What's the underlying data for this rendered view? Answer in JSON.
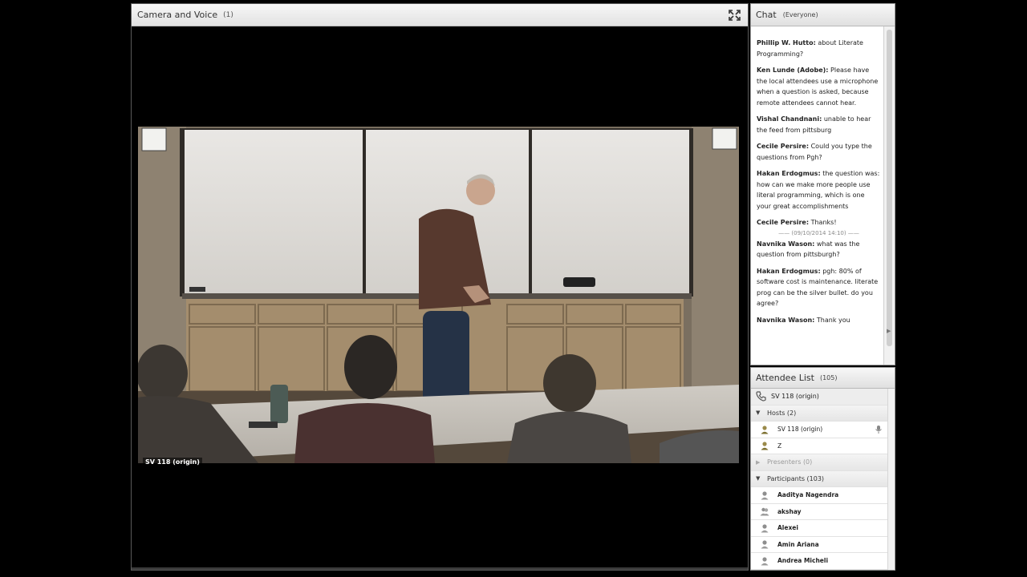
{
  "camera_pod": {
    "title": "Camera and Voice",
    "count": "(1)",
    "video_label": "SV 118 (origin)"
  },
  "chat_pod": {
    "title": "Chat",
    "scope": "(Everyone)",
    "messages": [
      {
        "sender": "Phillip W. Hutto:",
        "text": "about Literate Programming?"
      },
      {
        "sender": "Ken Lunde (Adobe):",
        "text": "Please have the local attendees use a microphone when a question is asked, because remote attendees cannot hear."
      },
      {
        "sender": "Vishal Chandnani:",
        "text": "unable to hear the feed from pittsburg"
      },
      {
        "sender": "Cecile Persire:",
        "text": "Could you type the questions from Pgh?"
      },
      {
        "sender": "Hakan Erdogmus:",
        "text": "the question was: how can we make more people use literal programming, which is one your great accomplishments"
      },
      {
        "sender": "Cecile Persire:",
        "text": "Thanks!"
      },
      {
        "sender": "Navnika Wason:",
        "text": "what was the question from pittsburgh?"
      },
      {
        "sender": "Hakan Erdogmus:",
        "text": "pgh: 80% of software cost is maintenance. literate prog can be the silver bullet.  do you agree?"
      },
      {
        "sender": "Navnika Wason:",
        "text": "Thank you"
      }
    ],
    "divider": "—— (09/10/2014 14:10) ——"
  },
  "attendee_pod": {
    "title": "Attendee List",
    "count": "(105)",
    "origin": "SV 118 (origin)",
    "hosts_label": "Hosts (2)",
    "hosts": [
      "SV 118 (origin)",
      "Z"
    ],
    "presenters_label": "Presenters (0)",
    "participants_label": "Participants (103)",
    "participants": [
      "Aaditya Nagendra",
      "akshay",
      "Alexei",
      "Amin Ariana",
      "Andrea Micheli"
    ]
  }
}
